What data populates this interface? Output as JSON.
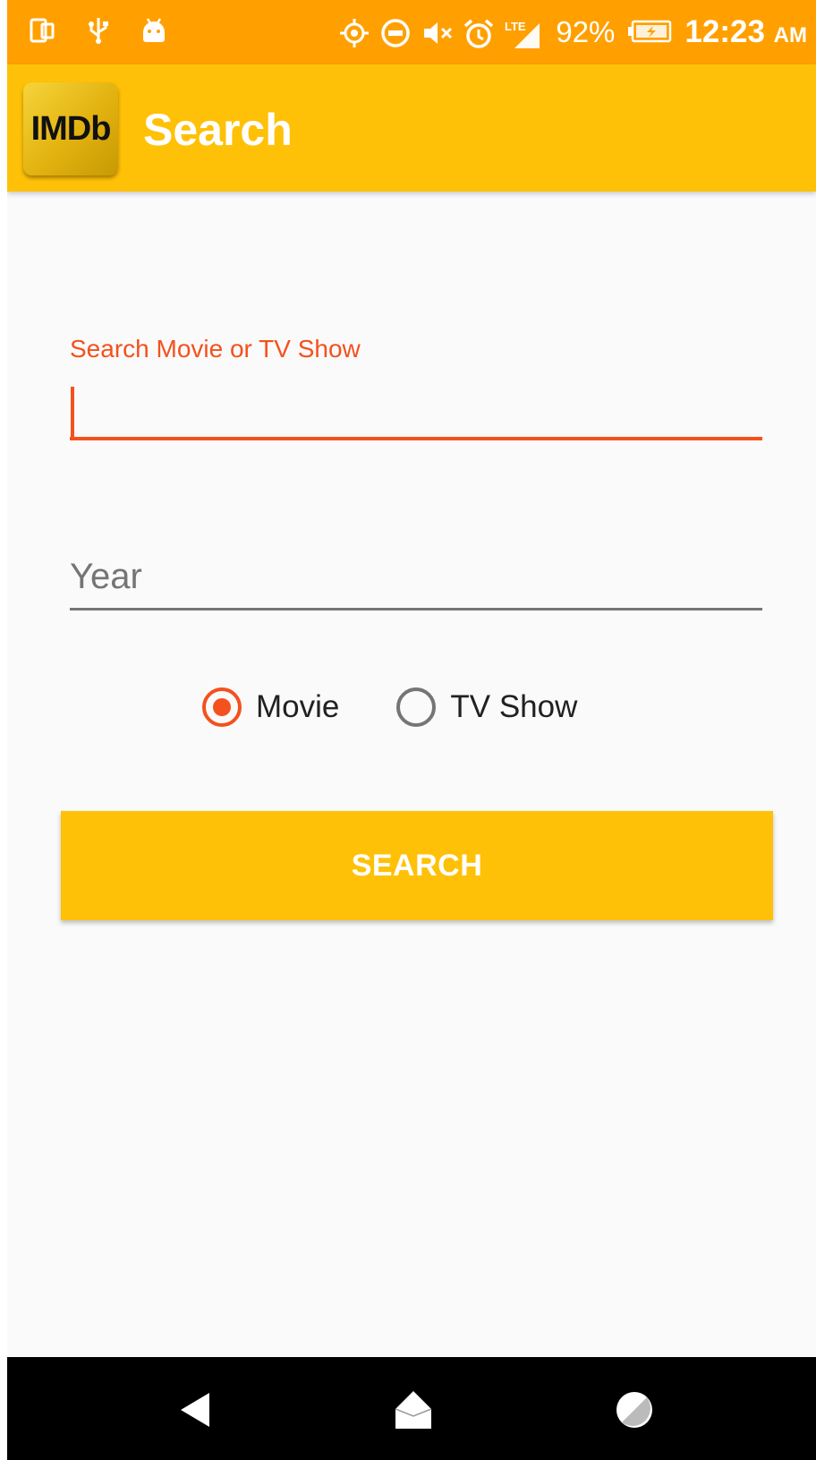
{
  "status_bar": {
    "battery_percent": "92%",
    "time": "12:23",
    "time_suffix": "AM",
    "network_label": "LTE",
    "icons": [
      "screen-mirror-icon",
      "usb-icon",
      "android-icon",
      "location-icon",
      "do-not-disturb-icon",
      "mute-icon",
      "alarm-icon",
      "lte-signal-icon",
      "battery-charging-icon"
    ]
  },
  "app_bar": {
    "logo_text": "IMDb",
    "title": "Search"
  },
  "form": {
    "title_field": {
      "label": "Search Movie or TV Show",
      "value": ""
    },
    "year_field": {
      "placeholder": "Year",
      "value": ""
    },
    "type_options": [
      {
        "label": "Movie",
        "selected": true
      },
      {
        "label": "TV Show",
        "selected": false
      }
    ],
    "search_button_label": "SEARCH"
  },
  "nav_bar": {
    "buttons": [
      "back-icon",
      "home-icon",
      "recents-icon"
    ]
  },
  "colors": {
    "status_bar": "#FFA000",
    "app_bar": "#FFC107",
    "accent": "#F4511E",
    "nav_bar": "#000000"
  }
}
